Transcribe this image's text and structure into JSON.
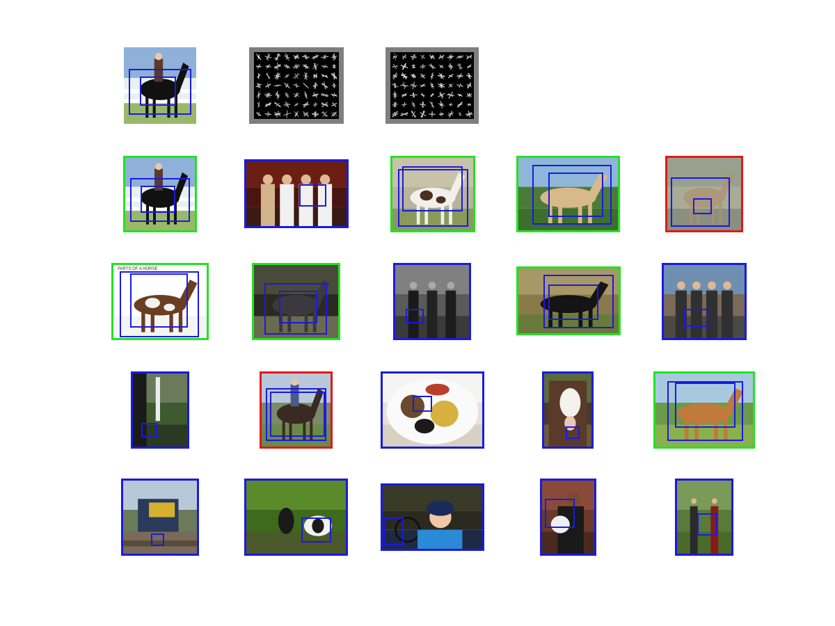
{
  "colors": {
    "background": "#ffffff",
    "detection_box": "#1a1adf",
    "correct_frame": "#22e322",
    "wrong_frame": "#e01818",
    "neutral_frame": "#1a1adf",
    "hog_background": "#000000",
    "hog_border": "#7f7f7f"
  },
  "header": {
    "items": [
      {
        "kind": "photo",
        "subject": "rider-on-black-horse"
      },
      {
        "kind": "hog-visualization",
        "subject": "positive-weights"
      },
      {
        "kind": "hog-visualization",
        "subject": "negative-weights"
      }
    ]
  },
  "grid": {
    "rows": [
      [
        {
          "subject": "rider-on-black-horse",
          "frame": "correct"
        },
        {
          "subject": "group-of-people",
          "frame": "neutral"
        },
        {
          "subject": "pinto-horse",
          "frame": "correct"
        },
        {
          "subject": "palomino-horse",
          "frame": "correct"
        },
        {
          "subject": "blurry-horse",
          "frame": "wrong"
        }
      ],
      [
        {
          "subject": "horse-diagram",
          "frame": "correct",
          "printed_text": "PARTS OF A HORSE"
        },
        {
          "subject": "two-horses",
          "frame": "correct"
        },
        {
          "subject": "men-in-suits",
          "frame": "neutral"
        },
        {
          "subject": "black-horse-field",
          "frame": "correct"
        },
        {
          "subject": "police-officers",
          "frame": "neutral"
        }
      ],
      [
        {
          "subject": "waterfall",
          "frame": "neutral"
        },
        {
          "subject": "cowboy-on-horse",
          "frame": "wrong"
        },
        {
          "subject": "food-plate",
          "frame": "neutral"
        },
        {
          "subject": "cow",
          "frame": "neutral"
        },
        {
          "subject": "chestnut-horse",
          "frame": "correct"
        }
      ],
      [
        {
          "subject": "train",
          "frame": "neutral"
        },
        {
          "subject": "cows-grazing",
          "frame": "neutral"
        },
        {
          "subject": "girl-with-bike",
          "frame": "neutral"
        },
        {
          "subject": "woman-with-baby",
          "frame": "neutral"
        },
        {
          "subject": "two-people-woods",
          "frame": "neutral"
        }
      ]
    ]
  }
}
